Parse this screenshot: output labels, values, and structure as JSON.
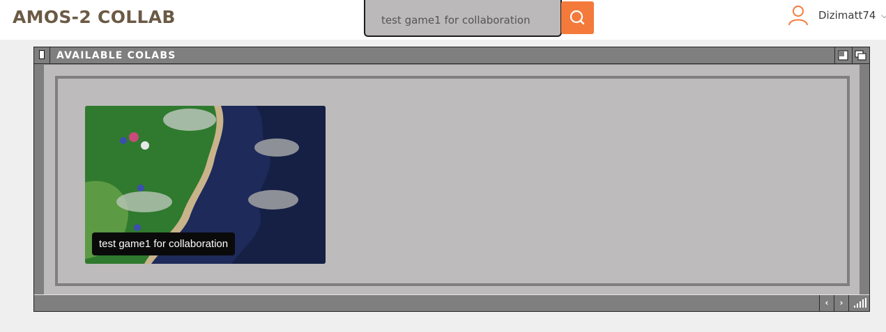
{
  "header": {
    "brand": "AMOS-2 COLLAB",
    "search": {
      "value": "test game1 for collaboration"
    },
    "user": {
      "name": "Dizimatt74"
    }
  },
  "window": {
    "title": "AVAILABLE COLABS",
    "cards": [
      {
        "label": "test game1 for collaboration",
        "thumbnail_icon": "game-map-thumbnail"
      }
    ]
  },
  "colors": {
    "accent": "#f47a3c",
    "brand": "#6b5a45",
    "window_gray": "#7f7f7f",
    "panel": "#bdbbbc"
  },
  "icons": {
    "search": "search-icon",
    "user": "user-icon",
    "chevron": "chevron-down-icon",
    "close": "close-icon",
    "restore": "restore-icon",
    "maximize": "maximize-icon",
    "prev": "chevron-left-icon",
    "next": "chevron-right-icon",
    "resize": "resize-grip-icon"
  }
}
